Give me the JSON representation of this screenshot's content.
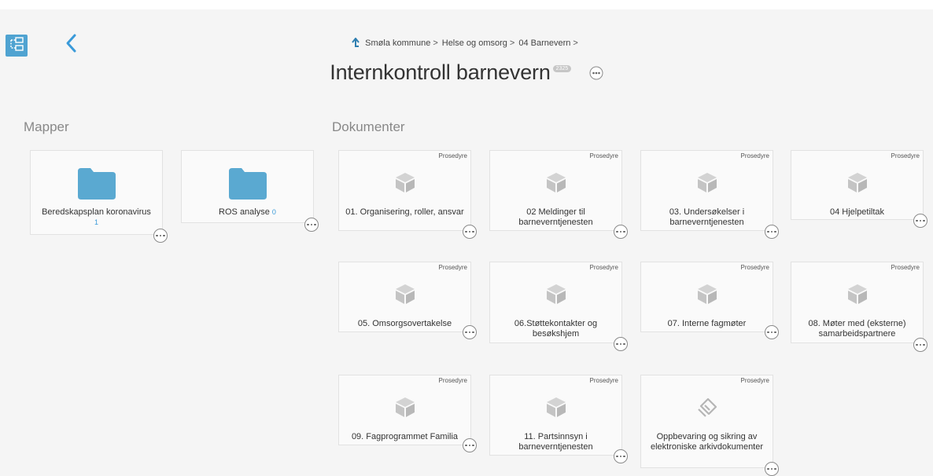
{
  "breadcrumb": {
    "items": [
      "Smøla kommune",
      "Helse og omsorg",
      "04 Barnevern"
    ]
  },
  "header": {
    "title": "Internkontroll barnevern",
    "doc_id": "2325"
  },
  "sections": {
    "folders_label": "Mapper",
    "documents_label": "Dokumenter"
  },
  "folders": [
    {
      "name": "Beredskapsplan koronavirus",
      "count": "1"
    },
    {
      "name": "ROS analyse",
      "count": "0"
    }
  ],
  "documents": [
    {
      "type": "Prosedyre",
      "title": "01. Organisering, roller, ansvar",
      "icon": "box-icon"
    },
    {
      "type": "Prosedyre",
      "title": "02 Meldinger til barneverntjenesten",
      "icon": "box-icon"
    },
    {
      "type": "Prosedyre",
      "title": "03. Undersøkelser i barneverntjenesten",
      "icon": "box-icon"
    },
    {
      "type": "Prosedyre",
      "title": "04 Hjelpetiltak",
      "icon": "box-icon"
    },
    {
      "type": "Prosedyre",
      "title": "05. Omsorgsovertakelse",
      "icon": "box-icon"
    },
    {
      "type": "Prosedyre",
      "title": "06.Støttekontakter og besøkshjem",
      "icon": "box-icon"
    },
    {
      "type": "Prosedyre",
      "title": "07. Interne fagmøter",
      "icon": "box-icon"
    },
    {
      "type": "Prosedyre",
      "title": "08. Møter med (eksterne) samarbeidspartnere",
      "icon": "box-icon"
    },
    {
      "type": "Prosedyre",
      "title": "09. Fagprogrammet Familia",
      "icon": "box-icon"
    },
    {
      "type": "Prosedyre",
      "title": "11. Partsinnsyn i barneverntjenesten",
      "icon": "box-icon"
    },
    {
      "type": "Prosedyre",
      "title": "Oppbevaring og sikring av elektroniske arkivdokumenter",
      "icon": "archive-icon"
    }
  ],
  "colors": {
    "accent": "#4fa3d1",
    "folder": "#5aa9d1",
    "doc_icon": "#c4c4c4",
    "background": "#f5f5f5"
  }
}
